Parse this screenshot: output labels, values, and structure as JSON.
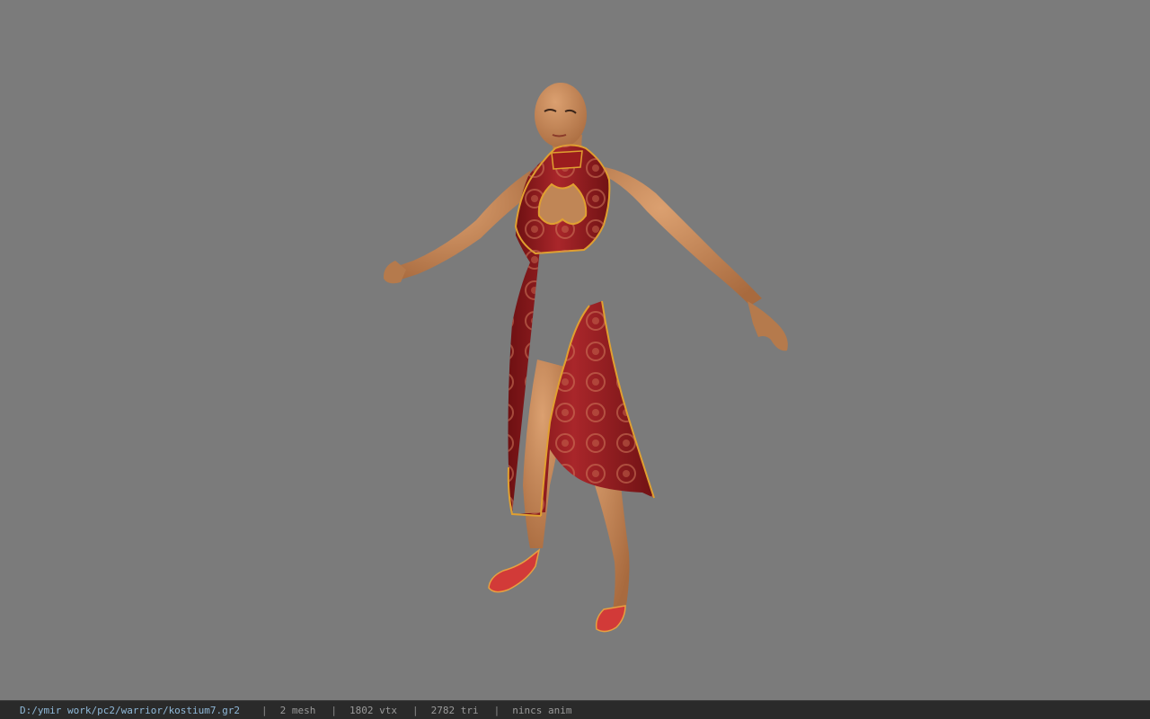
{
  "viewer": {
    "background_color": "#7b7b7b",
    "model_name": "character model in red lotus-pattern qipao dress"
  },
  "status_bar": {
    "file_path": "D:/ymir work/pc2/warrior/kostium7.gr2",
    "separator": "|",
    "mesh_count": "2 mesh",
    "vertex_count": "1802 vtx",
    "triangle_count": "2782 tri",
    "animation": "nincs anim"
  },
  "colors": {
    "dress": "#9b1c1e",
    "dress_trim": "#e0a030",
    "skin": "#c98a5a",
    "shoes": "#d23a38"
  }
}
